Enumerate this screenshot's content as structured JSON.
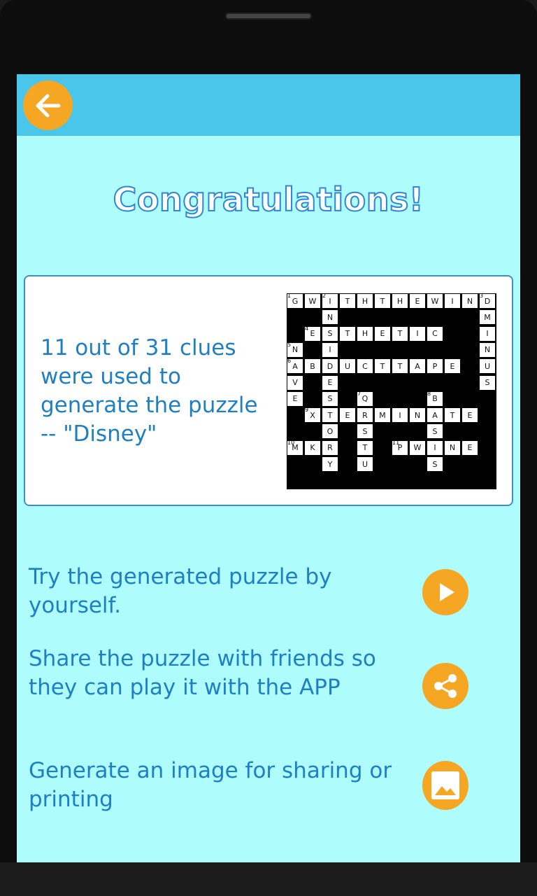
{
  "header": {
    "back_icon": "arrow-left-icon",
    "accent": "#f5a623",
    "bar_color": "#4ac6ea"
  },
  "title": "Congratulations!",
  "summary": "11 out of 31 clues were used to generate the puzzle -- \"Disney\"",
  "puzzle": {
    "cells": [
      {
        "r": 0,
        "c": 0,
        "ch": "G",
        "n": "1"
      },
      {
        "r": 0,
        "c": 1,
        "ch": "W"
      },
      {
        "r": 0,
        "c": 2,
        "ch": "I",
        "n": "2"
      },
      {
        "r": 0,
        "c": 3,
        "ch": "T"
      },
      {
        "r": 0,
        "c": 4,
        "ch": "H"
      },
      {
        "r": 0,
        "c": 5,
        "ch": "T"
      },
      {
        "r": 0,
        "c": 6,
        "ch": "H"
      },
      {
        "r": 0,
        "c": 7,
        "ch": "E"
      },
      {
        "r": 0,
        "c": 8,
        "ch": "W"
      },
      {
        "r": 0,
        "c": 9,
        "ch": "I"
      },
      {
        "r": 0,
        "c": 10,
        "ch": "N"
      },
      {
        "r": 0,
        "c": 11,
        "ch": "D",
        "n": "3"
      },
      {
        "r": 1,
        "c": 2,
        "ch": "N"
      },
      {
        "r": 1,
        "c": 11,
        "ch": "M"
      },
      {
        "r": 2,
        "c": 1,
        "ch": "E",
        "n": "4"
      },
      {
        "r": 2,
        "c": 2,
        "ch": "S"
      },
      {
        "r": 2,
        "c": 3,
        "ch": "T"
      },
      {
        "r": 2,
        "c": 4,
        "ch": "H"
      },
      {
        "r": 2,
        "c": 5,
        "ch": "E"
      },
      {
        "r": 2,
        "c": 6,
        "ch": "T"
      },
      {
        "r": 2,
        "c": 7,
        "ch": "I"
      },
      {
        "r": 2,
        "c": 8,
        "ch": "C"
      },
      {
        "r": 2,
        "c": 11,
        "ch": "I"
      },
      {
        "r": 3,
        "c": 0,
        "ch": "N",
        "n": "5"
      },
      {
        "r": 3,
        "c": 2,
        "ch": "I"
      },
      {
        "r": 3,
        "c": 11,
        "ch": "N"
      },
      {
        "r": 4,
        "c": 0,
        "ch": "A",
        "n": "6"
      },
      {
        "r": 4,
        "c": 1,
        "ch": "B"
      },
      {
        "r": 4,
        "c": 2,
        "ch": "D"
      },
      {
        "r": 4,
        "c": 3,
        "ch": "U"
      },
      {
        "r": 4,
        "c": 4,
        "ch": "C"
      },
      {
        "r": 4,
        "c": 5,
        "ch": "T"
      },
      {
        "r": 4,
        "c": 6,
        "ch": "T"
      },
      {
        "r": 4,
        "c": 7,
        "ch": "A"
      },
      {
        "r": 4,
        "c": 8,
        "ch": "P"
      },
      {
        "r": 4,
        "c": 9,
        "ch": "E"
      },
      {
        "r": 4,
        "c": 11,
        "ch": "U"
      },
      {
        "r": 5,
        "c": 0,
        "ch": "V"
      },
      {
        "r": 5,
        "c": 2,
        "ch": "E"
      },
      {
        "r": 5,
        "c": 11,
        "ch": "S"
      },
      {
        "r": 6,
        "c": 0,
        "ch": "E"
      },
      {
        "r": 6,
        "c": 2,
        "ch": "S"
      },
      {
        "r": 6,
        "c": 4,
        "ch": "Q",
        "n": "7"
      },
      {
        "r": 6,
        "c": 8,
        "ch": "B",
        "n": "8"
      },
      {
        "r": 7,
        "c": 1,
        "ch": "X",
        "n": "9"
      },
      {
        "r": 7,
        "c": 2,
        "ch": "T"
      },
      {
        "r": 7,
        "c": 3,
        "ch": "E"
      },
      {
        "r": 7,
        "c": 4,
        "ch": "R"
      },
      {
        "r": 7,
        "c": 5,
        "ch": "M"
      },
      {
        "r": 7,
        "c": 6,
        "ch": "I"
      },
      {
        "r": 7,
        "c": 7,
        "ch": "N"
      },
      {
        "r": 7,
        "c": 8,
        "ch": "A"
      },
      {
        "r": 7,
        "c": 9,
        "ch": "T"
      },
      {
        "r": 7,
        "c": 10,
        "ch": "E"
      },
      {
        "r": 8,
        "c": 2,
        "ch": "O"
      },
      {
        "r": 8,
        "c": 4,
        "ch": "S"
      },
      {
        "r": 8,
        "c": 8,
        "ch": "S"
      },
      {
        "r": 9,
        "c": 0,
        "ch": "M",
        "n": "10"
      },
      {
        "r": 9,
        "c": 1,
        "ch": "K"
      },
      {
        "r": 9,
        "c": 2,
        "ch": "R"
      },
      {
        "r": 9,
        "c": 4,
        "ch": "T"
      },
      {
        "r": 9,
        "c": 6,
        "ch": "P",
        "n": "11"
      },
      {
        "r": 9,
        "c": 7,
        "ch": "W"
      },
      {
        "r": 9,
        "c": 8,
        "ch": "I"
      },
      {
        "r": 9,
        "c": 9,
        "ch": "N"
      },
      {
        "r": 9,
        "c": 10,
        "ch": "E"
      },
      {
        "r": 10,
        "c": 2,
        "ch": "Y"
      },
      {
        "r": 10,
        "c": 4,
        "ch": "U"
      },
      {
        "r": 10,
        "c": 8,
        "ch": "S"
      }
    ]
  },
  "actions": [
    {
      "label": "Try the generated puzzle by yourself.",
      "icon": "play-icon"
    },
    {
      "label": "Share the puzzle with friends so they can play it with the APP",
      "icon": "share-icon"
    },
    {
      "label": "Generate an image for sharing or printing",
      "icon": "image-icon"
    }
  ]
}
